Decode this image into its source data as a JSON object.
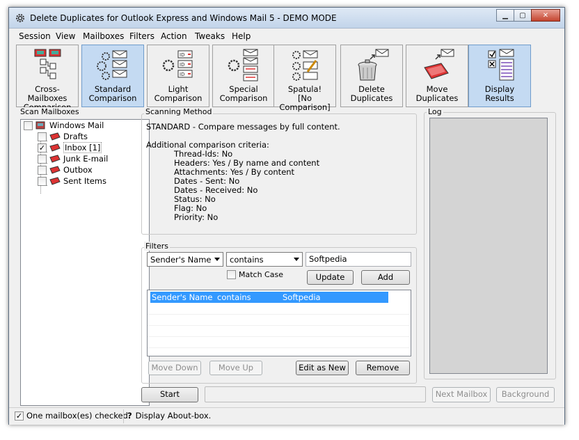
{
  "window": {
    "title": "Delete Duplicates for Outlook Express and Windows Mail 5 - DEMO MODE",
    "minimize": "▁",
    "maximize": "▢",
    "close": "✕"
  },
  "menu": [
    "Session",
    "View",
    "Mailboxes",
    "Filters",
    "Action",
    "Tweaks",
    "Help"
  ],
  "toolbar": [
    {
      "line1": "Cross-Mailboxes",
      "line2": "Comparison",
      "active": false
    },
    {
      "line1": "Standard",
      "line2": "Comparison",
      "active": true
    },
    {
      "line1": "Light",
      "line2": "Comparison",
      "active": false
    },
    {
      "line1": "Special",
      "line2": "Comparison",
      "active": false
    },
    {
      "line1": "Spatula!",
      "line2": "[No Comparison]",
      "active": false
    },
    {
      "line1": "Delete",
      "line2": "Duplicates",
      "active": false
    },
    {
      "line1": "Move",
      "line2": "Duplicates",
      "active": false
    },
    {
      "line1": "Display",
      "line2": "Results",
      "active": true
    }
  ],
  "scan": {
    "label": "Scan Mailboxes",
    "root": "Windows Mail",
    "folders": [
      {
        "name": "Drafts",
        "checked": false
      },
      {
        "name": "Inbox [1]",
        "checked": true
      },
      {
        "name": "Junk E-mail",
        "checked": false
      },
      {
        "name": "Outbox",
        "checked": false
      },
      {
        "name": "Sent Items",
        "checked": false
      }
    ]
  },
  "method": {
    "label": "Scanning Method",
    "summary": "STANDARD - Compare messages by full content.",
    "criteria_heading": "Additional comparison criteria:",
    "criteria": [
      "Thread-Ids: No",
      "Headers: Yes / By name and content",
      "Attachments: Yes / By content",
      "Dates - Sent: No",
      "Dates - Received: No",
      "Status: No",
      "Flag: No",
      "Priority: No"
    ]
  },
  "filters": {
    "label": "Filters",
    "field": "Sender's Name",
    "operator": "contains",
    "value": "Softpedia",
    "match_case": "Match Case",
    "update": "Update",
    "add": "Add",
    "rows": [
      {
        "field": "Sender's Name",
        "operator": "contains",
        "value": "Softpedia"
      }
    ],
    "move_down": "Move Down",
    "move_up": "Move Up",
    "edit_as_new": "Edit as New",
    "remove": "Remove"
  },
  "log": {
    "label": "Log"
  },
  "actions": {
    "start": "Start",
    "next_mailbox": "Next Mailbox",
    "background": "Background"
  },
  "status": {
    "checked": "One mailbox(es) checked.",
    "about": "Display About-box."
  },
  "colors": {
    "accent": "#3399ff",
    "active_tool": "#c4daf2"
  }
}
